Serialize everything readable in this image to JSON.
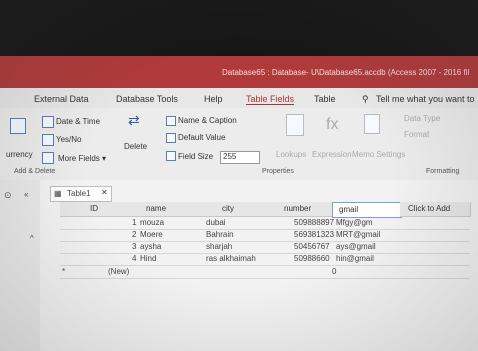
{
  "window": {
    "title": "Database65 : Database- U\\Database65.accdb (Access 2007 - 2016 fil"
  },
  "menu": {
    "tabs": [
      "External Data",
      "Database Tools",
      "Help",
      "Table Fields",
      "Table"
    ],
    "active": "Table Fields",
    "tell_me": "Tell me what you want to"
  },
  "ribbon": {
    "currency": "urrency",
    "date_time": "Date & Time",
    "yes_no": "Yes/No",
    "more_fields": "More Fields",
    "delete": "Delete",
    "name_caption": "Name & Caption",
    "default_value": "Default Value",
    "field_size_label": "Field Size",
    "field_size_value": "255",
    "properties_group": "Properties",
    "add_delete_group": "Add & Delete",
    "lookups": "Lookups",
    "expression": "Expression",
    "memo_settings": "Memo Settings",
    "data_type": "Data Type",
    "format": "Format",
    "formatting": "Formatting"
  },
  "sheet": {
    "tab_label": "Table1",
    "columns": [
      "ID",
      "name",
      "city",
      "number",
      "gmail",
      "Click to Add"
    ],
    "rows": [
      {
        "id": "1",
        "name": "mouza",
        "city": "dubai",
        "number": "509888897",
        "gmail": "Mfgy@gm"
      },
      {
        "id": "2",
        "name": "Moere",
        "city": "Bahrain",
        "number": "569381323",
        "gmail": "MRT@gmail"
      },
      {
        "id": "3",
        "name": "aysha",
        "city": "sharjah",
        "number": "50456767",
        "gmail": "ays@gmail"
      },
      {
        "id": "4",
        "name": "Hind",
        "city": "ras alkhaimah",
        "number": "50988660",
        "gmail": "hin@gmail"
      }
    ],
    "new_row": {
      "id": "(New)",
      "number": "0"
    }
  }
}
